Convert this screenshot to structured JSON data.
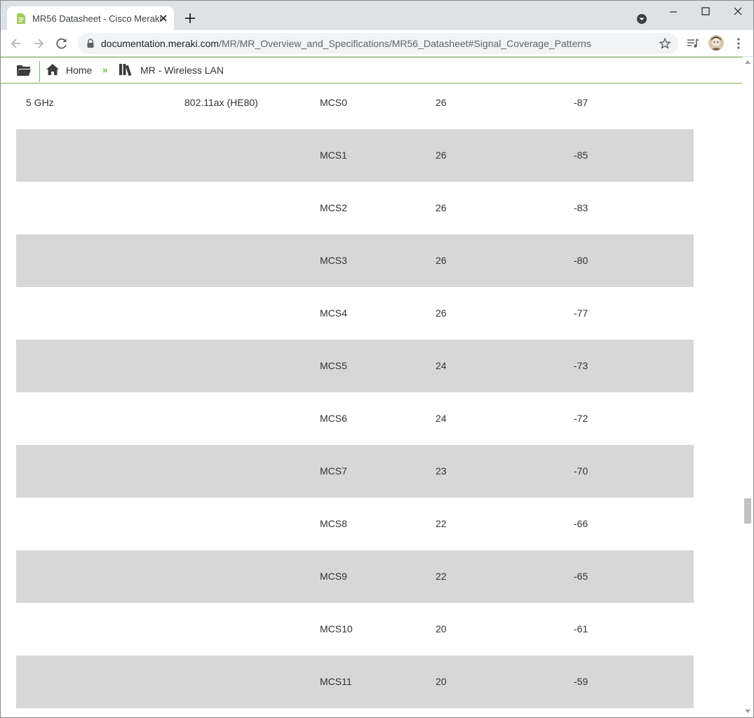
{
  "browser": {
    "tab_title": "MR56 Datasheet - Cisco Meraki",
    "url_host": "documentation.meraki.com",
    "url_path": "/MR/MR_Overview_and_Specifications/MR56_Datasheet#Signal_Coverage_Patterns"
  },
  "site_nav": {
    "home_label": "Home",
    "separator": "»",
    "section_label": "MR - Wireless LAN"
  },
  "table": {
    "rows": [
      {
        "band": "5 GHz",
        "mode": "802.11ax (HE80)",
        "mcs": "MCS0",
        "power": "26",
        "sensitivity": "-87"
      },
      {
        "band": "",
        "mode": "",
        "mcs": "MCS1",
        "power": "26",
        "sensitivity": "-85"
      },
      {
        "band": "",
        "mode": "",
        "mcs": "MCS2",
        "power": "26",
        "sensitivity": "-83"
      },
      {
        "band": "",
        "mode": "",
        "mcs": "MCS3",
        "power": "26",
        "sensitivity": "-80"
      },
      {
        "band": "",
        "mode": "",
        "mcs": "MCS4",
        "power": "26",
        "sensitivity": "-77"
      },
      {
        "band": "",
        "mode": "",
        "mcs": "MCS5",
        "power": "24",
        "sensitivity": "-73"
      },
      {
        "band": "",
        "mode": "",
        "mcs": "MCS6",
        "power": "24",
        "sensitivity": "-72"
      },
      {
        "band": "",
        "mode": "",
        "mcs": "MCS7",
        "power": "23",
        "sensitivity": "-70"
      },
      {
        "band": "",
        "mode": "",
        "mcs": "MCS8",
        "power": "22",
        "sensitivity": "-66"
      },
      {
        "band": "",
        "mode": "",
        "mcs": "MCS9",
        "power": "22",
        "sensitivity": "-65"
      },
      {
        "band": "",
        "mode": "",
        "mcs": "MCS10",
        "power": "20",
        "sensitivity": "-61"
      },
      {
        "band": "",
        "mode": "",
        "mcs": "MCS11",
        "power": "20",
        "sensitivity": "-59"
      }
    ]
  },
  "colors": {
    "accent_green": "#7db544",
    "row_shade": "#d7d7d7"
  }
}
